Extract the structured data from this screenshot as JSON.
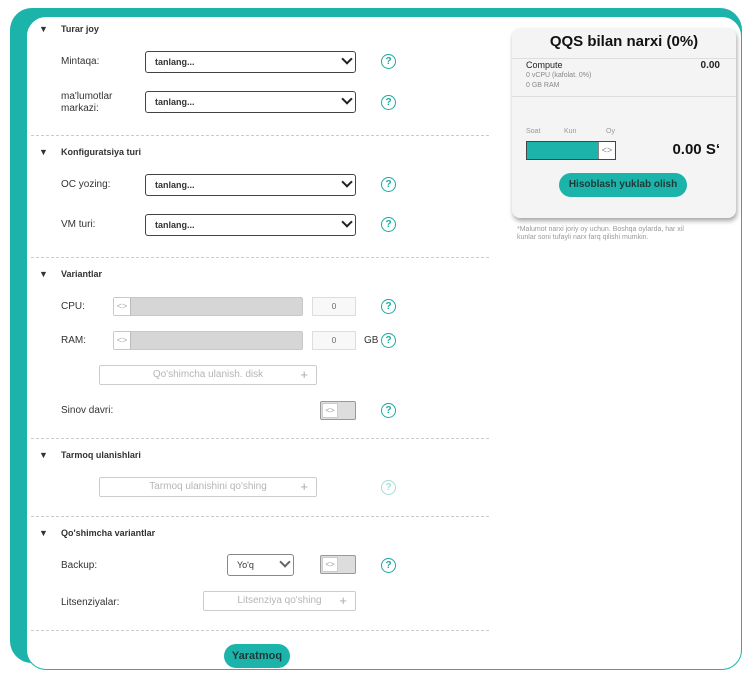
{
  "sections": {
    "housing": "Turar joy",
    "config": "Konfiguratsiya turi",
    "variants": "Variantlar",
    "network": "Tarmoq ulanishlari",
    "extra": "Qo'shimcha variantlar"
  },
  "fields": {
    "region_label": "Mintaqa:",
    "region_value": "tanlang...",
    "dc_label_1": "ma'lumotlar",
    "dc_label_2": "markazi:",
    "dc_value": "tanlang...",
    "os_label": "OC yozing:",
    "os_value": "tanlang...",
    "vm_label": "VM turi:",
    "vm_value": "tanlang...",
    "cpu_label": "CPU:",
    "cpu_value": "0",
    "ram_label": "RAM:",
    "ram_value": "0",
    "ram_unit": "GB",
    "disk_button": "Qo'shimcha ulanish. disk",
    "trial_label": "Sinov davri:",
    "network_button": "Tarmoq ulanishini qo'shing",
    "backup_label": "Backup:",
    "backup_value": "Yo'q",
    "license_label": "Litsenziyalar:",
    "license_button": "Litsenziya qo'shing",
    "create_button": "Yaratmoq"
  },
  "summary": {
    "title": "QQS bilan narxi (0%)",
    "compute_label": "Compute",
    "compute_value": "0.00",
    "vcpu_line": "0 vCPU (kafolat. 0%)",
    "ram_line": "0 GB RAM",
    "period_hour": "Soat",
    "period_day": "Kun",
    "period_month": "Oy",
    "total": "0.00 S‘",
    "calc_button": "Hisoblash yuklab olish",
    "note_1": "*Malumot narxi joriy oy uchun. Boshqa oylarda, har xil",
    "note_2": "kunlar soni tufayli narx farq qilishi mumkin."
  },
  "icons": {
    "help": "question-circle-icon",
    "collapse": "triangle-down-icon",
    "chevron": "chevron-down-icon",
    "plus": "plus-icon",
    "slider_grip": "slider-grip-icon"
  },
  "colors": {
    "accent": "#1bb3aa"
  }
}
